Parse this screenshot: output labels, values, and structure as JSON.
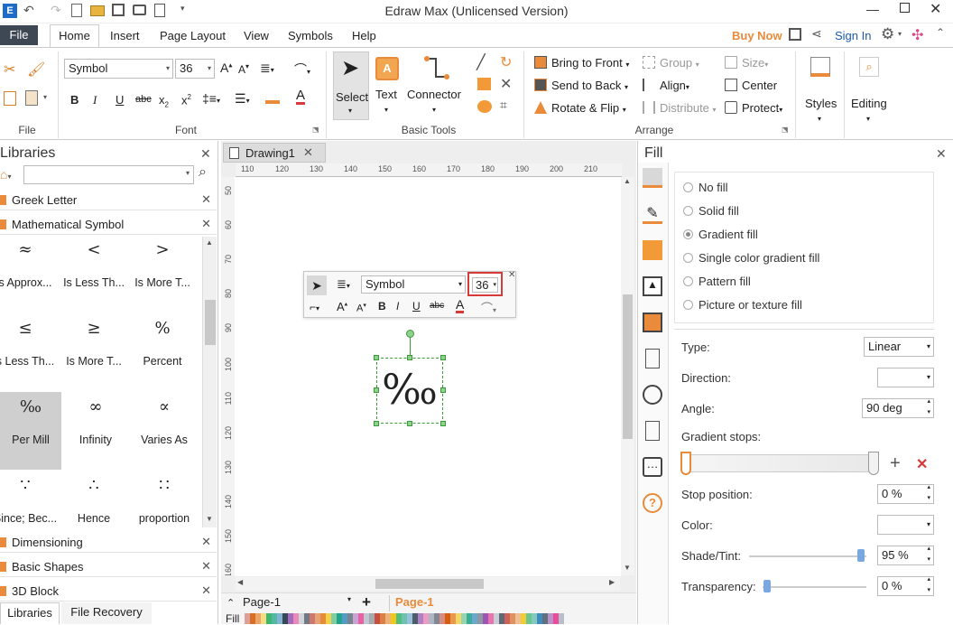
{
  "app": {
    "title": "Edraw Max (Unlicensed Version)"
  },
  "menu": {
    "file": "File",
    "items": [
      "Home",
      "Insert",
      "Page Layout",
      "View",
      "Symbols",
      "Help"
    ],
    "buy_now": "Buy Now",
    "sign_in": "Sign In"
  },
  "ribbon": {
    "font_name": "Symbol",
    "font_size": "36",
    "groups": {
      "file": "File",
      "font": "Font",
      "basic_tools": "Basic Tools",
      "arrange": "Arrange"
    },
    "tools": {
      "select": "Select",
      "text": "Text",
      "connector": "Connector"
    },
    "arrange": {
      "bring_to_front": "Bring to Front",
      "send_to_back": "Send to Back",
      "rotate_flip": "Rotate & Flip",
      "group": "Group",
      "align": "Align",
      "distribute": "Distribute",
      "size": "Size",
      "center": "Center",
      "protect": "Protect"
    },
    "styles": "Styles",
    "editing": "Editing"
  },
  "libraries": {
    "title": "Libraries",
    "search_placeholder": "",
    "categories_top": [
      "Greek Letter",
      "Mathematical Symbol"
    ],
    "symbols": [
      {
        "glyph": "≈",
        "name": "s Approx..."
      },
      {
        "glyph": "<",
        "name": "Is Less Th..."
      },
      {
        "glyph": ">",
        "name": "Is More T..."
      },
      {
        "glyph": "≤",
        "name": "s Less Th..."
      },
      {
        "glyph": "≥",
        "name": "Is More T..."
      },
      {
        "glyph": "%",
        "name": "Percent"
      },
      {
        "glyph": "‰",
        "name": "Per Mill"
      },
      {
        "glyph": "∞",
        "name": "Infinity"
      },
      {
        "glyph": "∝",
        "name": "Varies As"
      },
      {
        "glyph": "∵",
        "name": "Since; Bec..."
      },
      {
        "glyph": "∴",
        "name": "Hence"
      },
      {
        "glyph": "∷",
        "name": "proportion"
      }
    ],
    "categories_bottom": [
      "Dimensioning",
      "Basic Shapes",
      "3D Block"
    ],
    "tabs": [
      "Libraries",
      "File Recovery"
    ]
  },
  "document": {
    "tab": "Drawing1",
    "ruler_h": [
      "110",
      "120",
      "130",
      "140",
      "150",
      "160",
      "170",
      "180",
      "190",
      "200",
      "210"
    ],
    "ruler_v": [
      "50",
      "60",
      "70",
      "80",
      "90",
      "100",
      "110",
      "120",
      "130",
      "140",
      "150",
      "160"
    ],
    "shape_glyph": "‰",
    "mini_toolbar": {
      "font": "Symbol",
      "size": "36"
    },
    "page_selector": "Page-1",
    "page_tab": "Page-1",
    "fill_label": "Fill"
  },
  "fill_panel": {
    "title": "Fill",
    "options": [
      "No fill",
      "Solid fill",
      "Gradient fill",
      "Single color gradient fill",
      "Pattern fill",
      "Picture or texture fill"
    ],
    "selected": "Gradient fill",
    "type_label": "Type:",
    "type_value": "Linear",
    "direction_label": "Direction:",
    "angle_label": "Angle:",
    "angle_value": "90 deg",
    "stops_label": "Gradient stops:",
    "stop_pos_label": "Stop position:",
    "stop_pos_value": "0 %",
    "color_label": "Color:",
    "shade_label": "Shade/Tint:",
    "shade_value": "95 %",
    "transparency_label": "Transparency:",
    "transparency_value": "0 %"
  },
  "colors": {
    "accent": "#e98b3a",
    "file_tab": "#3e4854",
    "highlight_red": "#d83a3a"
  }
}
